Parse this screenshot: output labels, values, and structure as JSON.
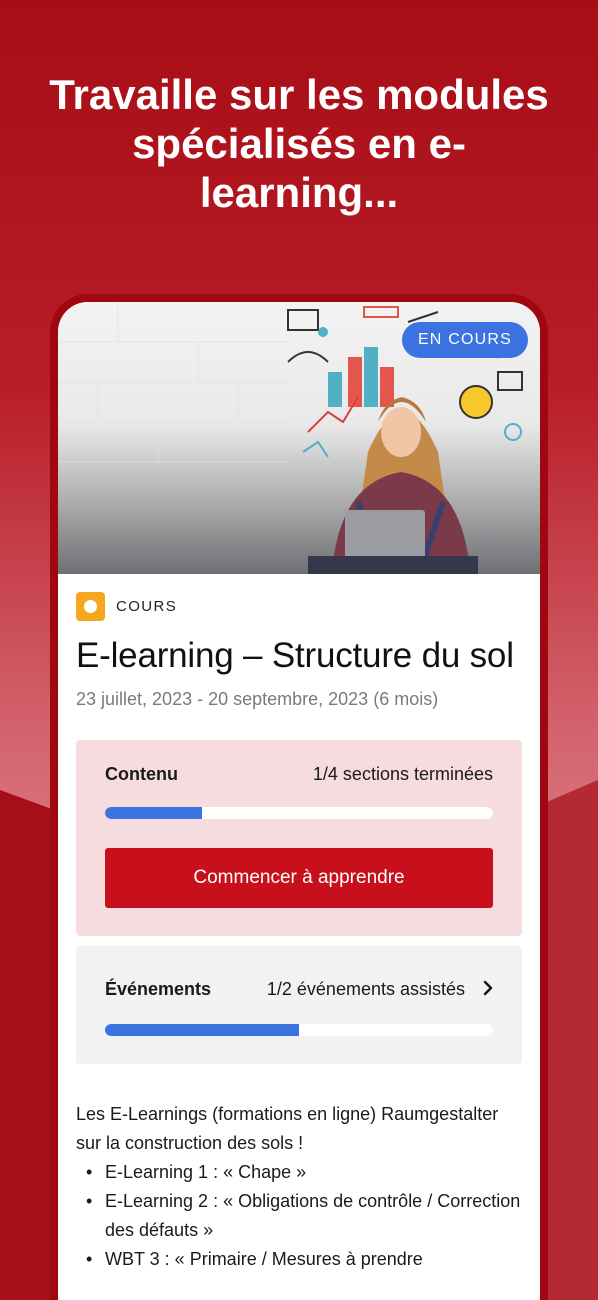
{
  "headline": "Travaille sur les modules spécialisés en e-learning...",
  "hero": {
    "status_badge": "EN COURS"
  },
  "course": {
    "type": "COURS",
    "title": "E-learning – Structure du sol",
    "dates": "23 juillet, 2023 - 20 septembre, 2023 (6 mois)"
  },
  "content_card": {
    "label": "Contenu",
    "progress_text": "1/4 sections terminées",
    "progress": 0.25,
    "button": "Commencer à apprendre"
  },
  "events_card": {
    "label": "Événements",
    "progress_text": "1/2 événements assistés",
    "progress": 0.5
  },
  "description": {
    "intro": "Les E-Learnings (formations en ligne) Raumgestalter sur la construction des sols !",
    "items": [
      "E-Learning 1 : « Chape »",
      "E-Learning 2 : « Obligations de contrôle / Correction des défauts »",
      "WBT 3 : « Primaire / Mesures à prendre"
    ]
  },
  "colors": {
    "brand_red": "#c8101c",
    "accent_blue": "#3b73e0",
    "course_orange": "#f4a71f"
  }
}
